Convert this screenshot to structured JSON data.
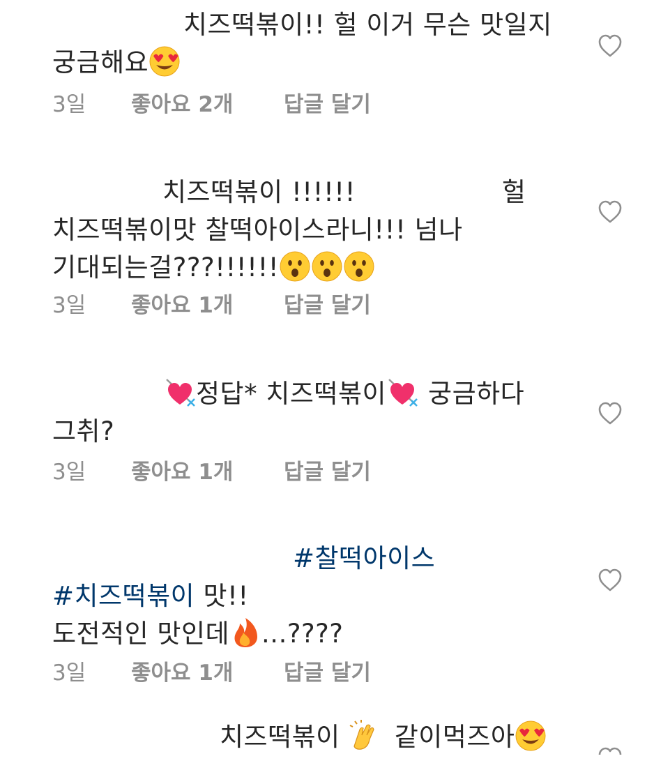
{
  "comments": [
    {
      "lines": [
        "치즈떡볶이!! 헐 이거 무슨 맛일지",
        "궁금해요"
      ],
      "emoji_end": "heart-eyes-emoji",
      "time": "3일",
      "likes": "좋아요 2개",
      "reply": "답글 달기"
    },
    {
      "lines": [
        "치즈떡볶이 !!!!!!",
        "헐",
        "치즈떡볶이맛 찰떡아이스라니!!! 넘나",
        "기대되는걸???!!!!!!"
      ],
      "emoji_end": "surprised-face-emoji",
      "time": "3일",
      "likes": "좋아요 1개",
      "reply": "답글 달기"
    },
    {
      "lines": [
        "정답* 치즈떡볶이",
        "궁금하다",
        "그취?"
      ],
      "emoji_inline": "heart-with-arrow-emoji",
      "time": "3일",
      "likes": "좋아요 1개",
      "reply": "답글 달기"
    },
    {
      "lines": [
        "#찰떡아이스",
        "#치즈떡볶이",
        " 맛!!",
        "도전적인 맛인데",
        "...????"
      ],
      "emoji_inline": "fire-emoji",
      "time": "3일",
      "likes": "좋아요 1개",
      "reply": "답글 달기"
    },
    {
      "lines": [
        "치즈떡볶이",
        "같이먹즈아"
      ],
      "emoji_inline": "clapping-hands-emoji",
      "emoji_end": "heart-eyes-emoji"
    }
  ],
  "icons": {
    "like": "heart-outline-icon"
  },
  "colors": {
    "text": "#262626",
    "meta": "#8e8e8e",
    "hashtag": "#00376b"
  }
}
